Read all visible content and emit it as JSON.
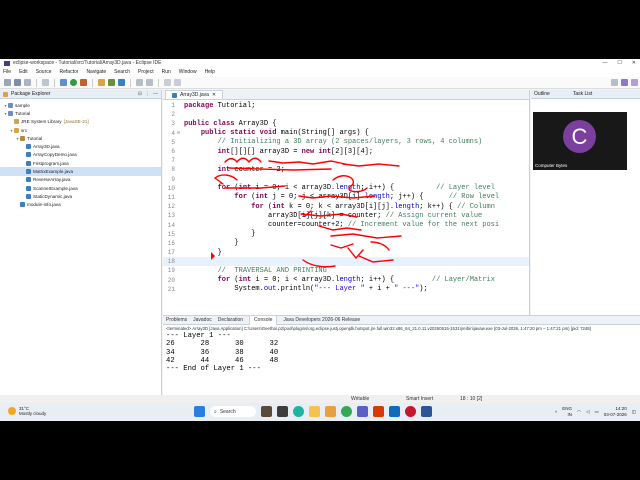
{
  "window": {
    "title": "eclipse-workspace - Tutorial/src/Tutorial/Array3D.java - Eclipse IDE"
  },
  "menu": [
    "File",
    "Edit",
    "Source",
    "Refactor",
    "Navigate",
    "Search",
    "Project",
    "Run",
    "Window",
    "Help"
  ],
  "package_explorer": {
    "title": "Package Explorer",
    "items": [
      {
        "label": "sample",
        "level": 0,
        "type": "project"
      },
      {
        "label": "Tutorial",
        "level": 0,
        "type": "project"
      },
      {
        "label": "JRE System Library",
        "decoration": "[JavaSE-21]",
        "level": 1,
        "type": "library"
      },
      {
        "label": "src",
        "level": 1,
        "type": "folder"
      },
      {
        "label": "Tutorial",
        "level": 2,
        "type": "package"
      },
      {
        "label": "Array3D.java",
        "level": 3,
        "type": "java"
      },
      {
        "label": "ArrayCopyDemo.java",
        "level": 3,
        "type": "java"
      },
      {
        "label": "Firstprogram.java",
        "level": 3,
        "type": "java"
      },
      {
        "label": "MatrixExample.java",
        "level": 3,
        "type": "java"
      },
      {
        "label": "ReverseArray.java",
        "level": 3,
        "type": "java"
      },
      {
        "label": "ScannerExample.java",
        "level": 3,
        "type": "java"
      },
      {
        "label": "StaticDynamic.java",
        "level": 3,
        "type": "java"
      },
      {
        "label": "module-info.java",
        "level": 2,
        "type": "java"
      }
    ]
  },
  "editor": {
    "tab": "Array3D.java",
    "lines": [
      {
        "n": "1",
        "html": "<span class=\"kw\">package</span> Tutorial;"
      },
      {
        "n": "2",
        "html": ""
      },
      {
        "n": "3",
        "html": "<span class=\"kw\">public class</span> Array3D {"
      },
      {
        "n": "4",
        "html": "    <span class=\"kw\">public static void</span> main(String[] args) {"
      },
      {
        "n": "5",
        "html": "        <span class=\"cm\">// Initializing a 3D array (2 spaces/layers, 3 rows, 4 columns)</span>"
      },
      {
        "n": "6",
        "html": "        <span class=\"kw\">int</span>[][][] array3D = <span class=\"kw\">new int</span>[2][3][4];"
      },
      {
        "n": "7",
        "html": ""
      },
      {
        "n": "8",
        "html": "        <span class=\"kw\">int</span> counter = 2;"
      },
      {
        "n": "9",
        "html": ""
      },
      {
        "n": "10",
        "html": "        <span class=\"kw\">for</span> (<span class=\"kw\">int</span> i = 0; i &lt; array3D.<span class=\"fd\">length</span>; i++) {          <span class=\"cm\">// Layer level</span>"
      },
      {
        "n": "11",
        "html": "            <span class=\"kw\">for</span> (<span class=\"kw\">int</span> j = 0; j &lt; array3D[i].<span class=\"fd\">length</span>; j++) {      <span class=\"cm\">// Row level</span>"
      },
      {
        "n": "12",
        "html": "                <span class=\"kw\">for</span> (<span class=\"kw\">int</span> k = 0; k &lt; array3D[i][j].<span class=\"fd\">length</span>; k++) { <span class=\"cm\">// Column</span>"
      },
      {
        "n": "13",
        "html": "                    array3D[i][j][k] = counter; <span class=\"cm\">// Assign current value</span>"
      },
      {
        "n": "14",
        "html": "                    counter=counter+2; <span class=\"cm\">// Increment value for the next posi</span>"
      },
      {
        "n": "15",
        "html": "                }"
      },
      {
        "n": "16",
        "html": "            }"
      },
      {
        "n": "17",
        "html": "        }"
      },
      {
        "n": "18",
        "html": ""
      },
      {
        "n": "19",
        "html": "        <span class=\"cm\">//  TRAVERSAL AND PRINTING</span>"
      },
      {
        "n": "20",
        "html": "        <span class=\"kw\">for</span> (<span class=\"kw\">int</span> i = 0; i &lt; array3D.<span class=\"fd\">length</span>; i++) {         <span class=\"cm\">// Layer/Matrix</span>"
      },
      {
        "n": "21",
        "html": "            System.<span class=\"fd\">out</span>.println(<span class=\"st\">\"--- Layer \"</span> + i + <span class=\"st\">\" ---\"</span>);"
      }
    ]
  },
  "outline": {
    "tabs": [
      "Outline",
      "Task List"
    ]
  },
  "webcam": {
    "initial": "C",
    "name": "Computer Bytes"
  },
  "console": {
    "tabs": [
      "Problems",
      "Javadoc",
      "Declaration",
      "Console",
      "Java Developers 2026-06 Release"
    ],
    "terminated": "<terminated> Array3D [Java Application] C:\\Users\\Geetha\\.p2\\pool\\plugins\\org.eclipse.justj.openjdk.hotspot.jre.full.win32.x86_64_21.0.11.v20260515-1531\\jre\\bin\\javaw.exe  (03-Jul-2026, 1:47:20 pm – 1:47:21 pm) [pid: 7248]",
    "output": [
      "--- Layer 1 ---",
      "26      28      30      32",
      "34      36      38      40",
      "42      44      46      48",
      "--- End of Layer 1 ---"
    ]
  },
  "status": {
    "writable": "Writable",
    "insert": "Smart Insert",
    "position": "18 : 10 [2]"
  },
  "taskbar": {
    "temp": "31°C",
    "weather": "Mostly cloudy",
    "search": "Search",
    "lang1": "ENG",
    "lang2": "IN",
    "time": "14:20",
    "date": "03-07-2026"
  }
}
